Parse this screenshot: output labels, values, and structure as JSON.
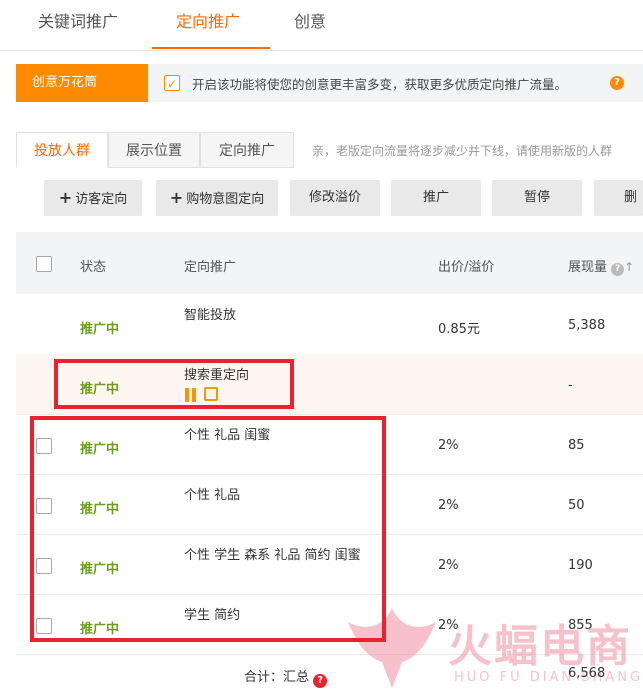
{
  "top_tabs": [
    {
      "label": "关键词推广",
      "active": false
    },
    {
      "label": "定向推广",
      "active": true
    },
    {
      "label": "创意",
      "active": false
    }
  ],
  "kaleido": {
    "button_label": "创意万花筒",
    "checked": true,
    "text": "开启该功能将使您的创意更丰富多变，获取更多优质定向推广流量。",
    "help_icon": "?"
  },
  "sub_tabs": [
    {
      "label": "投放人群",
      "active": true
    },
    {
      "label": "展示位置",
      "active": false
    },
    {
      "label": "定向推广",
      "active": false
    }
  ],
  "sub_notice": "亲，老版定向流量将逐步减少并下线，请使用新版的人群",
  "toolbar": {
    "visitor_targeting": "访客定向",
    "purchase_intent": "购物意图定向",
    "modify_premium": "修改溢价",
    "promote": "推广",
    "pause": "暂停",
    "delete_partial": "删除"
  },
  "table_header": {
    "status": "状态",
    "targeting": "定向推广",
    "bid": "出价/溢价",
    "impressions": "展现量"
  },
  "rows": [
    {
      "status": "推广中",
      "name": "智能投放",
      "bid": "0.85元",
      "impressions": "5,388"
    },
    {
      "status": "推广中",
      "name": "搜索重定向",
      "bid": "",
      "impressions": "-"
    },
    {
      "status": "推广中",
      "name": "个性 礼品 闺蜜",
      "bid": "2%",
      "impressions": "85"
    },
    {
      "status": "推广中",
      "name": "个性 礼品",
      "bid": "2%",
      "impressions": "50"
    },
    {
      "status": "推广中",
      "name": "个性 学生 森系 礼品 简约 闺蜜",
      "bid": "2%",
      "impressions": "190"
    },
    {
      "status": "推广中",
      "name": "学生 简约",
      "bid": "2%",
      "impressions": "855"
    }
  ],
  "total": {
    "label": "合计：汇总",
    "value": "6,568"
  },
  "watermark": {
    "cn": "火蝠电商",
    "en": "HUO FU DIAN SHANG"
  },
  "colors": {
    "accent": "#ff6a00",
    "kaleido": "#ff8a00",
    "status_green": "#6a9d1f",
    "highlight_red": "#e8222e"
  }
}
